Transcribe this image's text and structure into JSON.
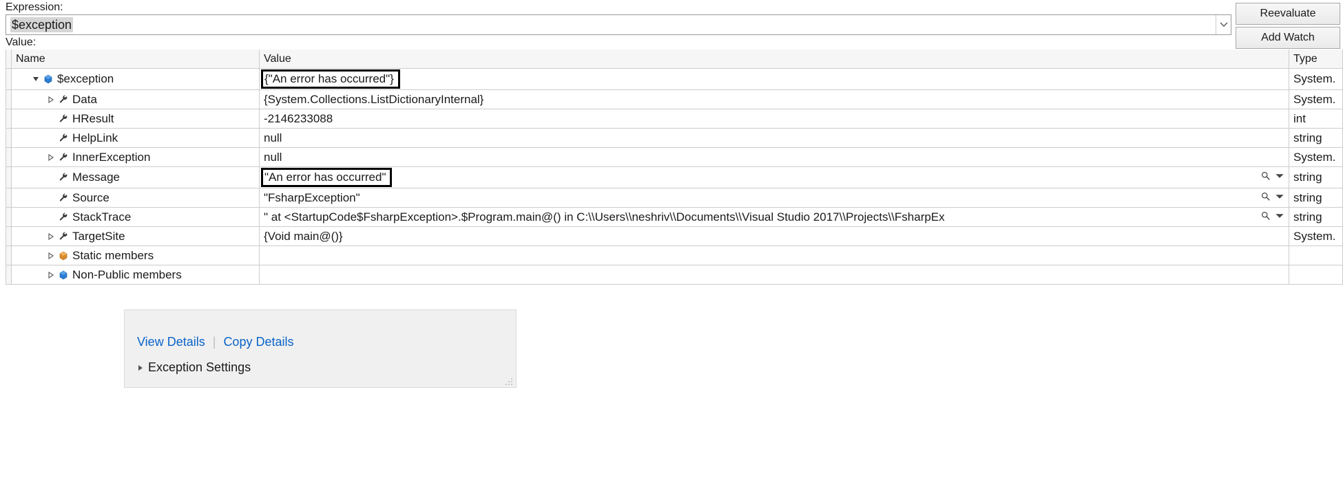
{
  "labels": {
    "expression": "Expression:",
    "value": "Value:"
  },
  "expression_input": "$exception",
  "buttons": {
    "reevaluate": "Reevaluate",
    "add_watch": "Add Watch"
  },
  "columns": {
    "name": "Name",
    "value": "Value",
    "type": "Type"
  },
  "rows": [
    {
      "indent": 1,
      "expander": "open",
      "icon": "object",
      "name": "$exception",
      "value": "{\"An error has occurred\"}",
      "type": "System.",
      "boxed": true,
      "visualizer": false
    },
    {
      "indent": 2,
      "expander": "closed",
      "icon": "wrench",
      "name": "Data",
      "value": "{System.Collections.ListDictionaryInternal}",
      "type": "System.",
      "boxed": false,
      "visualizer": false
    },
    {
      "indent": 2,
      "expander": "none",
      "icon": "wrench",
      "name": "HResult",
      "value": "-2146233088",
      "type": "int",
      "boxed": false,
      "visualizer": false
    },
    {
      "indent": 2,
      "expander": "none",
      "icon": "wrench",
      "name": "HelpLink",
      "value": "null",
      "type": "string",
      "boxed": false,
      "visualizer": false
    },
    {
      "indent": 2,
      "expander": "closed",
      "icon": "wrench",
      "name": "InnerException",
      "value": "null",
      "type": "System.",
      "boxed": false,
      "visualizer": false
    },
    {
      "indent": 2,
      "expander": "none",
      "icon": "wrench",
      "name": "Message",
      "value": "\"An error has occurred\"",
      "type": "string",
      "boxed": true,
      "visualizer": true
    },
    {
      "indent": 2,
      "expander": "none",
      "icon": "wrench",
      "name": "Source",
      "value": "\"FsharpException\"",
      "type": "string",
      "boxed": false,
      "visualizer": true
    },
    {
      "indent": 2,
      "expander": "none",
      "icon": "wrench",
      "name": "StackTrace",
      "value": "\"   at <StartupCode$FsharpException>.$Program.main@() in C:\\\\Users\\\\neshriv\\\\Documents\\\\Visual Studio 2017\\\\Projects\\\\FsharpEx",
      "type": "string",
      "boxed": false,
      "visualizer": true
    },
    {
      "indent": 2,
      "expander": "closed",
      "icon": "wrench",
      "name": "TargetSite",
      "value": "{Void main@()}",
      "type": "System.",
      "boxed": false,
      "visualizer": false
    },
    {
      "indent": 2,
      "expander": "closed",
      "icon": "static",
      "name": "Static members",
      "value": "",
      "type": "",
      "boxed": false,
      "visualizer": false
    },
    {
      "indent": 2,
      "expander": "closed",
      "icon": "object",
      "name": "Non-Public members",
      "value": "",
      "type": "",
      "boxed": false,
      "visualizer": false
    }
  ],
  "popup": {
    "view_details": "View Details",
    "copy_details": "Copy Details",
    "exception_settings": "Exception Settings"
  }
}
